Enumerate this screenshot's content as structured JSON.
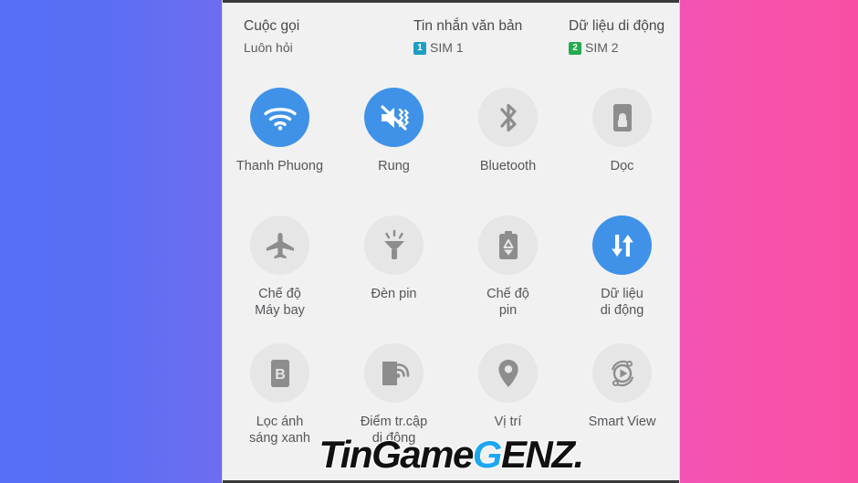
{
  "background": {
    "gradient_from": "#5570f5",
    "gradient_to": "#f84fa3"
  },
  "panel": {
    "background": "#f1f1f1",
    "accent_on": "#3f92e8",
    "highlight_color": "#f40d0d"
  },
  "status_header": [
    {
      "title": "Cuộc gọi",
      "sub": "Luôn hỏi",
      "badge": null,
      "badge_color": null
    },
    {
      "title": "Tin nhắn văn bản",
      "sub": "SIM 1",
      "badge": "1",
      "badge_color": "#1e9ec4"
    },
    {
      "title": "Dữ liệu di động",
      "sub": "SIM 2",
      "badge": "2",
      "badge_color": "#23ab4e"
    }
  ],
  "tiles": [
    [
      {
        "label": "Thanh Phuong",
        "icon": "wifi-icon",
        "state": "on"
      },
      {
        "label": "Rung",
        "icon": "vibrate-icon",
        "state": "on"
      },
      {
        "label": "Bluetooth",
        "icon": "bluetooth-icon",
        "state": "off"
      },
      {
        "label": "Dọc",
        "icon": "rotation-lock-icon",
        "state": "off"
      }
    ],
    [
      {
        "label": "Chế độ\nMáy bay",
        "icon": "airplane-icon",
        "state": "off"
      },
      {
        "label": "Đèn pin",
        "icon": "flashlight-icon",
        "state": "off"
      },
      {
        "label": "Chế độ\npin",
        "icon": "battery-saver-icon",
        "state": "off"
      },
      {
        "label": "Dữ liệu\ndi động",
        "icon": "mobile-data-icon",
        "state": "on"
      }
    ],
    [
      {
        "label": "Lọc ánh\nsáng xanh",
        "icon": "blue-light-filter-icon",
        "state": "off"
      },
      {
        "label": "Điểm tr.cập\ndi động",
        "icon": "hotspot-icon",
        "state": "off"
      },
      {
        "label": "Vị trí",
        "icon": "location-pin-icon",
        "state": "off"
      },
      {
        "label": "Smart View",
        "icon": "smart-view-icon",
        "state": "off"
      }
    ]
  ],
  "watermark": {
    "part1": "TinGame",
    "part2": "G",
    "part3": "ENZ."
  }
}
